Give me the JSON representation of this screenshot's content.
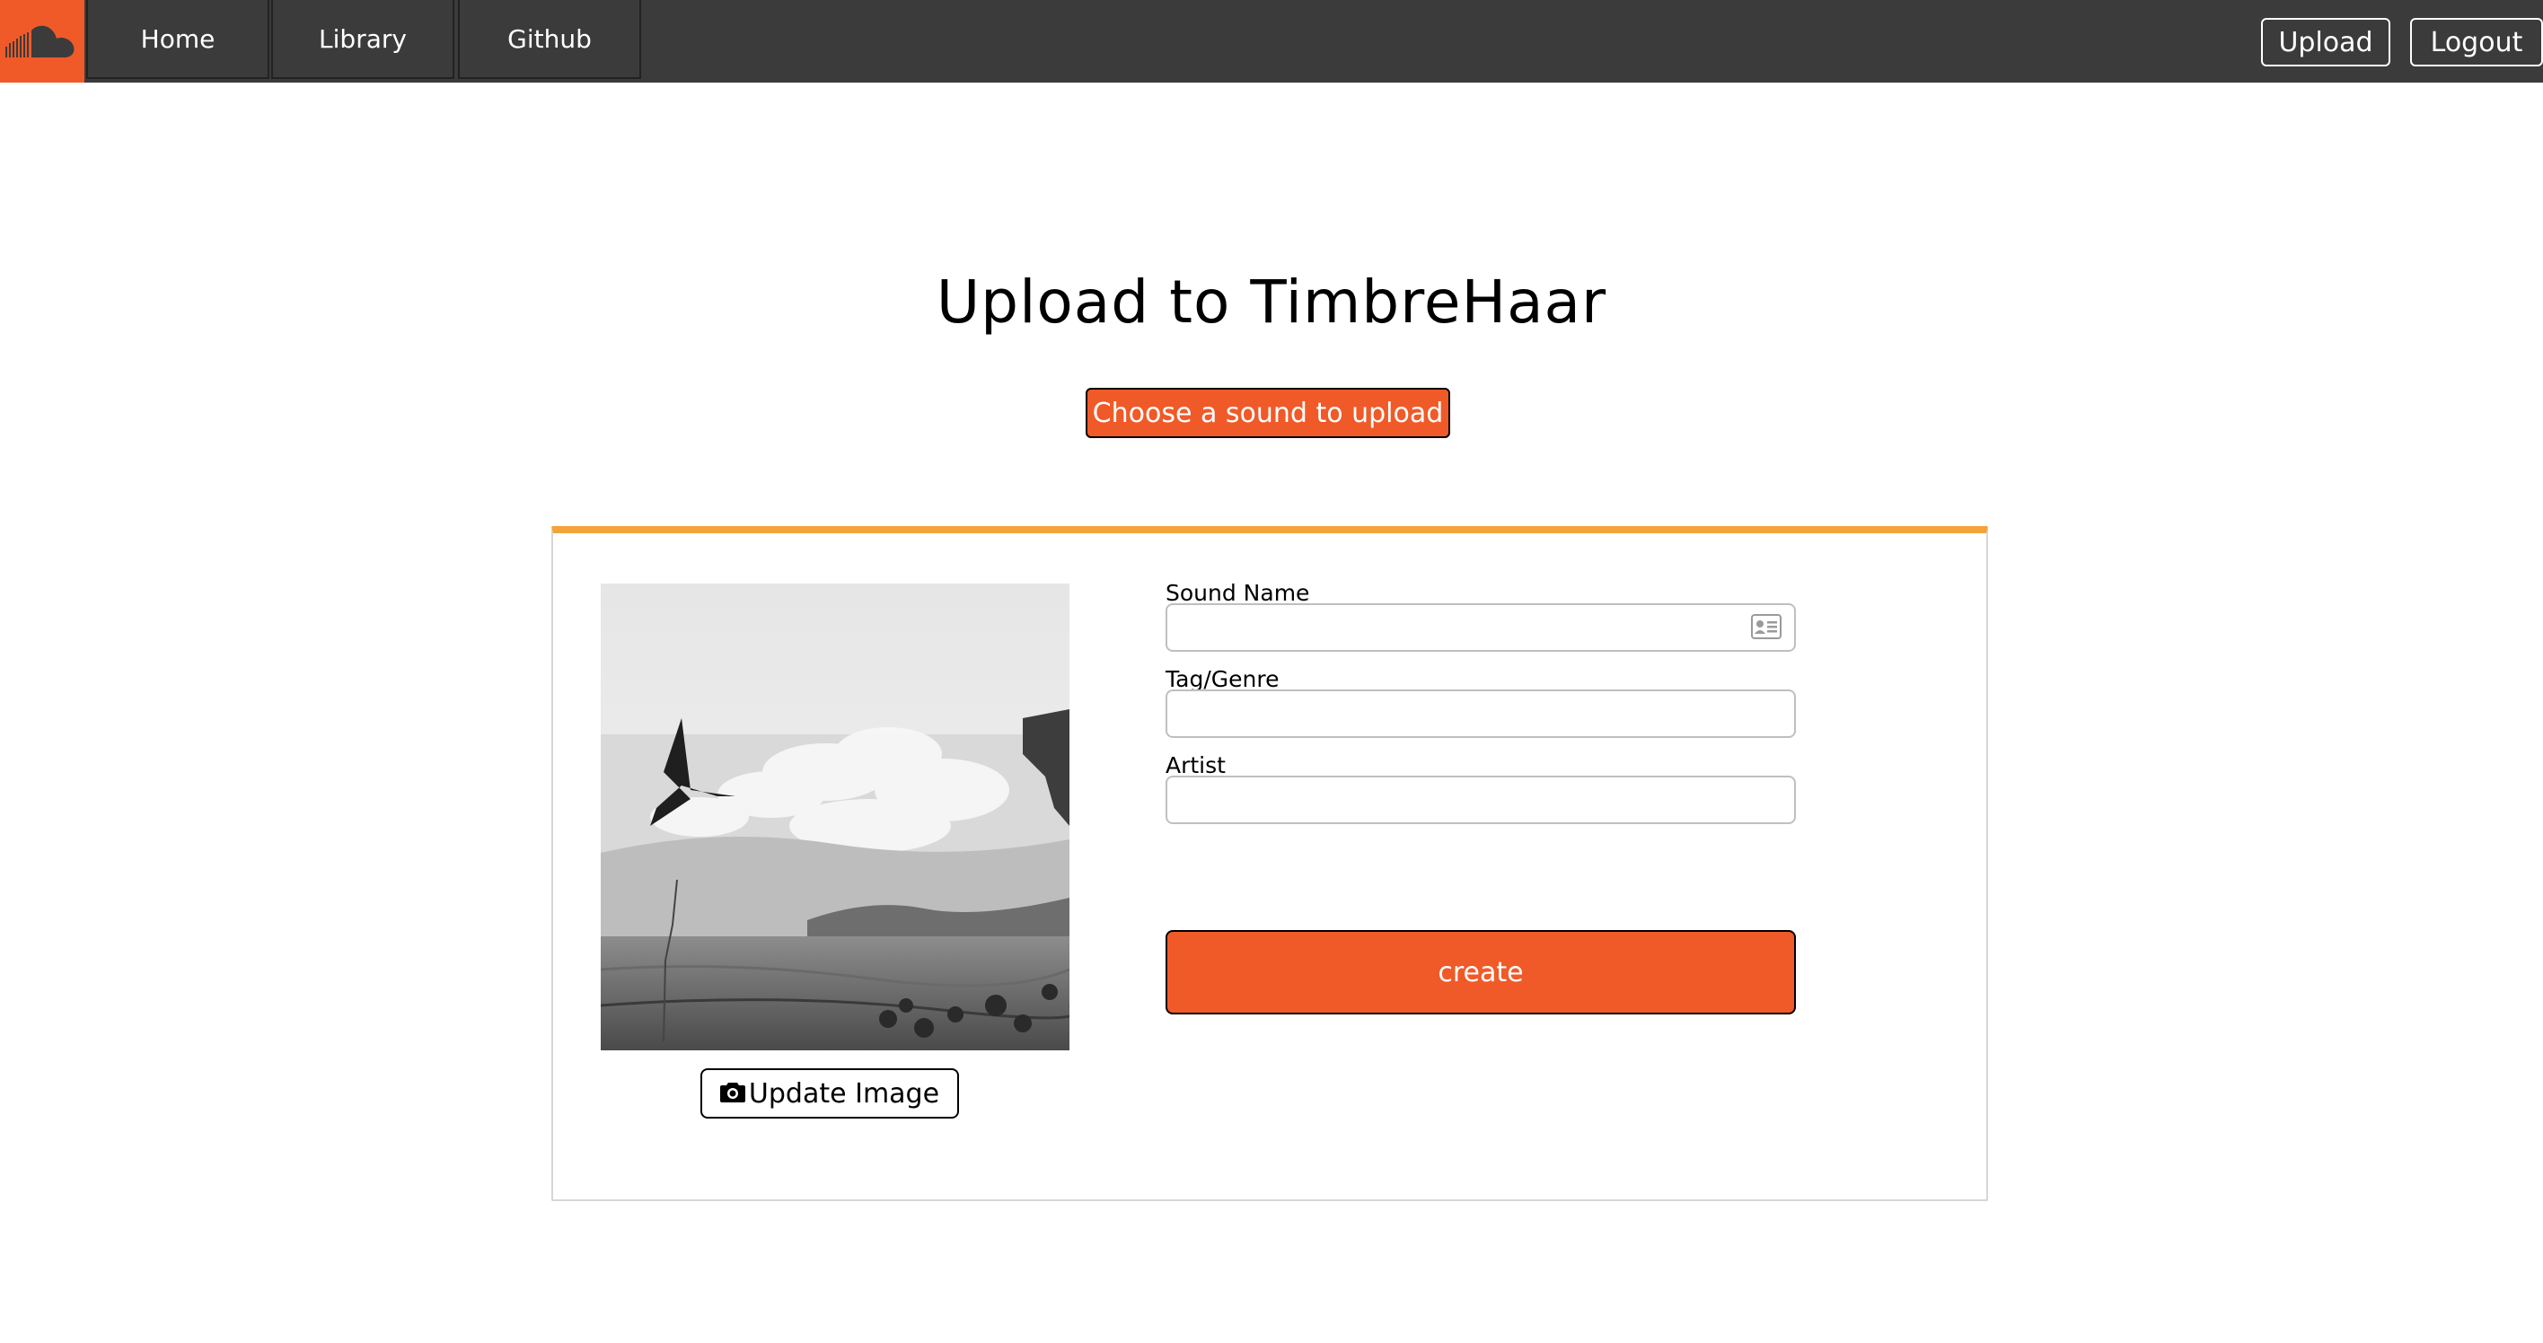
{
  "nav": {
    "tabs": [
      {
        "label": "Home"
      },
      {
        "label": "Library"
      },
      {
        "label": "Github"
      }
    ],
    "upload_label": "Upload",
    "logout_label": "Logout"
  },
  "page": {
    "title": "Upload to TimbreHaar",
    "choose_label": "Choose a sound to upload"
  },
  "form": {
    "cover_button_label": "Update Image",
    "fields": [
      {
        "label": "Sound Name",
        "value": ""
      },
      {
        "label": "Tag/Genre",
        "value": ""
      },
      {
        "label": "Artist",
        "value": ""
      }
    ],
    "submit_label": "create"
  },
  "colors": {
    "accent": "#f05a28",
    "navbar": "#3b3b3b",
    "panel_top_border": "#f3a33a"
  },
  "icons": [
    "soundcloud-logo-icon",
    "camera-icon",
    "contact-card-icon"
  ]
}
